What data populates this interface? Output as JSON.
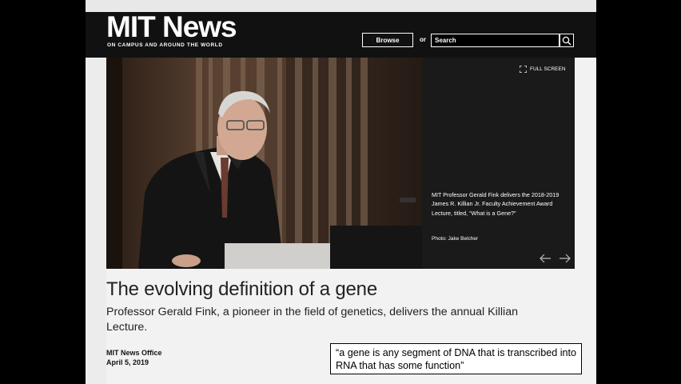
{
  "header": {
    "logo": "MIT News",
    "tagline": "ON CAMPUS AND AROUND THE WORLD",
    "browse_label": "Browse",
    "or_label": "or",
    "search_placeholder": "Search"
  },
  "slideshow": {
    "fullscreen_label": "FULL SCREEN",
    "caption": "MIT Professor Gerald Fink delivers the 2018-2019 James R. Killian Jr. Faculty Achievement Award Lecture, titled, “What is a Gene?”",
    "credit": "Photo: Jake Belcher"
  },
  "article": {
    "title": "The evolving definition of a gene",
    "subtitle": "Professor Gerald Fink, a pioneer in the field of genetics, delivers the annual Killian Lecture.",
    "office": "MIT News Office",
    "date": "April 5, 2019"
  },
  "quote": "“a gene is any segment of DNA that is transcribed into RNA that has some function”",
  "colors": {
    "header_bg": "#111111",
    "page_bg": "#f2f2f2",
    "caption_panel_bg": "#1a1a1a"
  }
}
